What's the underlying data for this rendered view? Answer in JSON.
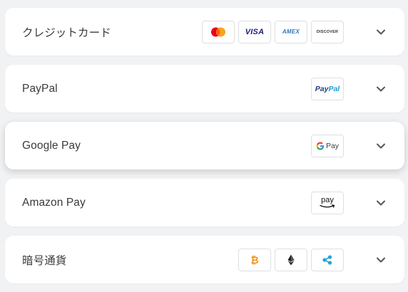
{
  "payment_methods": [
    {
      "label": "クレジットカード",
      "logos": [
        "mastercard-logo",
        "visa-logo",
        "amex-logo",
        "discover-logo"
      ],
      "logo_texts": {
        "visa": "VISA",
        "amex": "AMEX",
        "discover": "DISCOVER"
      }
    },
    {
      "label": "PayPal",
      "logos": [
        "paypal-logo"
      ],
      "logo_texts": {
        "paypal_pay": "Pay",
        "paypal_pal": "Pal"
      }
    },
    {
      "label": "Google Pay",
      "logos": [
        "google-pay-logo"
      ],
      "logo_texts": {
        "gpay": "Pay"
      }
    },
    {
      "label": "Amazon Pay",
      "logos": [
        "amazon-pay-logo"
      ],
      "logo_texts": {
        "amazon": "pay"
      }
    },
    {
      "label": "暗号通貨",
      "logos": [
        "bitcoin-logo",
        "ethereum-logo",
        "ripple-logo"
      ]
    }
  ],
  "icons": {
    "expand": "chevron-down-icon"
  },
  "colors": {
    "background": "#f1f2f4",
    "card": "#ffffff",
    "text": "#3a3a3a",
    "chevron": "#555555",
    "mastercard_red": "#eb001b",
    "mastercard_orange": "#f79e1b",
    "visa_blue": "#1a1f71",
    "amex_blue": "#2e77bc",
    "discover_orange": "#f58220",
    "paypal_dark": "#253b80",
    "paypal_light": "#179bd7",
    "bitcoin_orange": "#f7931a",
    "ripple_blue": "#23a4d9"
  }
}
